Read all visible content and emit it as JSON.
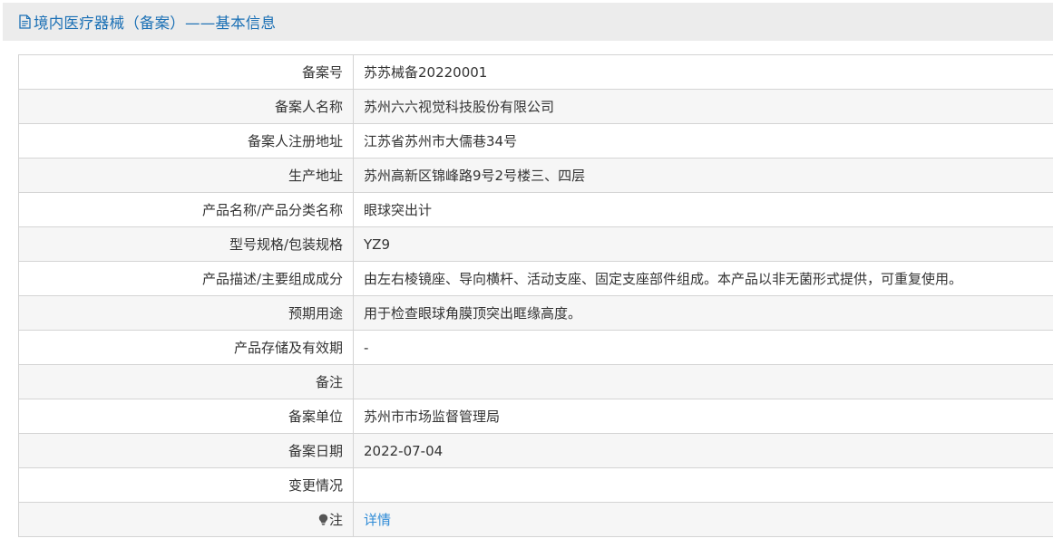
{
  "header": {
    "title": "境内医疗器械（备案）——基本信息",
    "icon": "document-icon",
    "title_color": "#1b70b5"
  },
  "rows": [
    {
      "label": "备案号",
      "value": "苏苏械备20220001"
    },
    {
      "label": "备案人名称",
      "value": "苏州六六视觉科技股份有限公司"
    },
    {
      "label": "备案人注册地址",
      "value": "江苏省苏州市大儒巷34号"
    },
    {
      "label": "生产地址",
      "value": "苏州高新区锦峰路9号2号楼三、四层"
    },
    {
      "label": "产品名称/产品分类名称",
      "value": "眼球突出计"
    },
    {
      "label": "型号规格/包装规格",
      "value": "YZ9"
    },
    {
      "label": "产品描述/主要组成成分",
      "value": "由左右棱镜座、导向横杆、活动支座、固定支座部件组成。本产品以非无菌形式提供，可重复使用。"
    },
    {
      "label": "预期用途",
      "value": "用于检查眼球角膜顶突出眶缘高度。"
    },
    {
      "label": "产品存储及有效期",
      "value": "-"
    },
    {
      "label": "备注",
      "value": ""
    },
    {
      "label": "备案单位",
      "value": "苏州市市场监督管理局"
    },
    {
      "label": "备案日期",
      "value": "2022-07-04"
    },
    {
      "label": "变更情况",
      "value": ""
    }
  ],
  "note": {
    "icon": "lightbulb-icon",
    "label": "注",
    "link_text": "详情",
    "link_color": "#2f8bd6"
  }
}
